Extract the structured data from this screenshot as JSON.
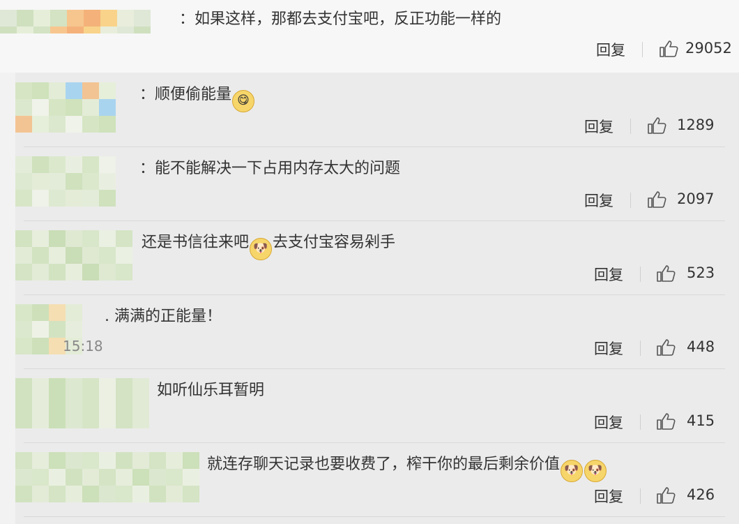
{
  "comments": [
    {
      "text_before": "：如果这样，那都去支付宝吧，反正功能一样的",
      "emojis": [],
      "text_after": "",
      "reply_label": "回复",
      "likes": "29052",
      "time": "",
      "avatar_colors": [
        "#dfe8d6",
        "#cfe0bf",
        "#e6eed9",
        "#d3e3c3",
        "#f7c68f",
        "#f4b27a",
        "#f9d38a",
        "#e8eedb"
      ]
    },
    {
      "text_before": "：顺便偷能量",
      "emojis": [
        "lick-emoji"
      ],
      "text_after": "",
      "reply_label": "回复",
      "likes": "1289",
      "time": "",
      "avatar_colors": [
        "#d6e5c4",
        "#cfe2bb",
        "#e3ecd6",
        "#a9d4ef",
        "#f3c493",
        "#e6efda",
        "#dce8cd",
        "#f0f3ea"
      ]
    },
    {
      "text_before": "：能不能解决一下占用内存太大的问题",
      "emojis": [],
      "text_after": "",
      "reply_label": "回复",
      "likes": "2097",
      "time": "",
      "avatar_colors": [
        "#e3ecd9",
        "#cfe1bd",
        "#dbe8cc",
        "#e9efe0",
        "#d7e6c6",
        "#eef2e8",
        "#dde9d0",
        "#e4ecd8"
      ]
    },
    {
      "text_before": "还是书信往来吧",
      "emojis": [
        "doge-emoji"
      ],
      "text_after": "去支付宝容易剁手",
      "reply_label": "回复",
      "likes": "523",
      "time": "",
      "avatar_colors": [
        "#d2e3c1",
        "#e7eedc",
        "#c9ddb6",
        "#dfe9d2",
        "#d8e6c9",
        "#eaf0e2",
        "#d4e4c4",
        "#e2ebd6"
      ]
    },
    {
      "text_before": ". 满满的正能量！",
      "emojis": [],
      "text_after": "",
      "reply_label": "回复",
      "likes": "448",
      "time": "15:18",
      "avatar_colors": [
        "#d8e7c8",
        "#cde0ba",
        "#f5deb2",
        "#e3ecd7",
        "#dbe8cd",
        "#eef2e6",
        "#d2e3c2",
        "#e6eddc"
      ]
    },
    {
      "text_before": "如听仙乐耳暂明",
      "emojis": [],
      "text_after": "",
      "reply_label": "回复",
      "likes": "415",
      "time": "",
      "avatar_colors": [
        "#d0e2bf",
        "#e5edda",
        "#cadfb7",
        "#dde8d0",
        "#d6e5c6",
        "#ebf0e3",
        "#d3e3c3",
        "#e1ead5"
      ]
    },
    {
      "text_before": "就连存聊天记录也要收费了，榨干你的最后剩余价值",
      "emojis": [
        "doge-emoji",
        "doge-emoji"
      ],
      "text_after": "",
      "reply_label": "回复",
      "likes": "426",
      "time": "",
      "avatar_colors": [
        "#d4e4c4",
        "#e6eddb",
        "#cce0b9",
        "#dbe7ce",
        "#d9e7ca",
        "#eaf0e1",
        "#d1e2c0",
        "#e3ebd7"
      ]
    }
  ]
}
